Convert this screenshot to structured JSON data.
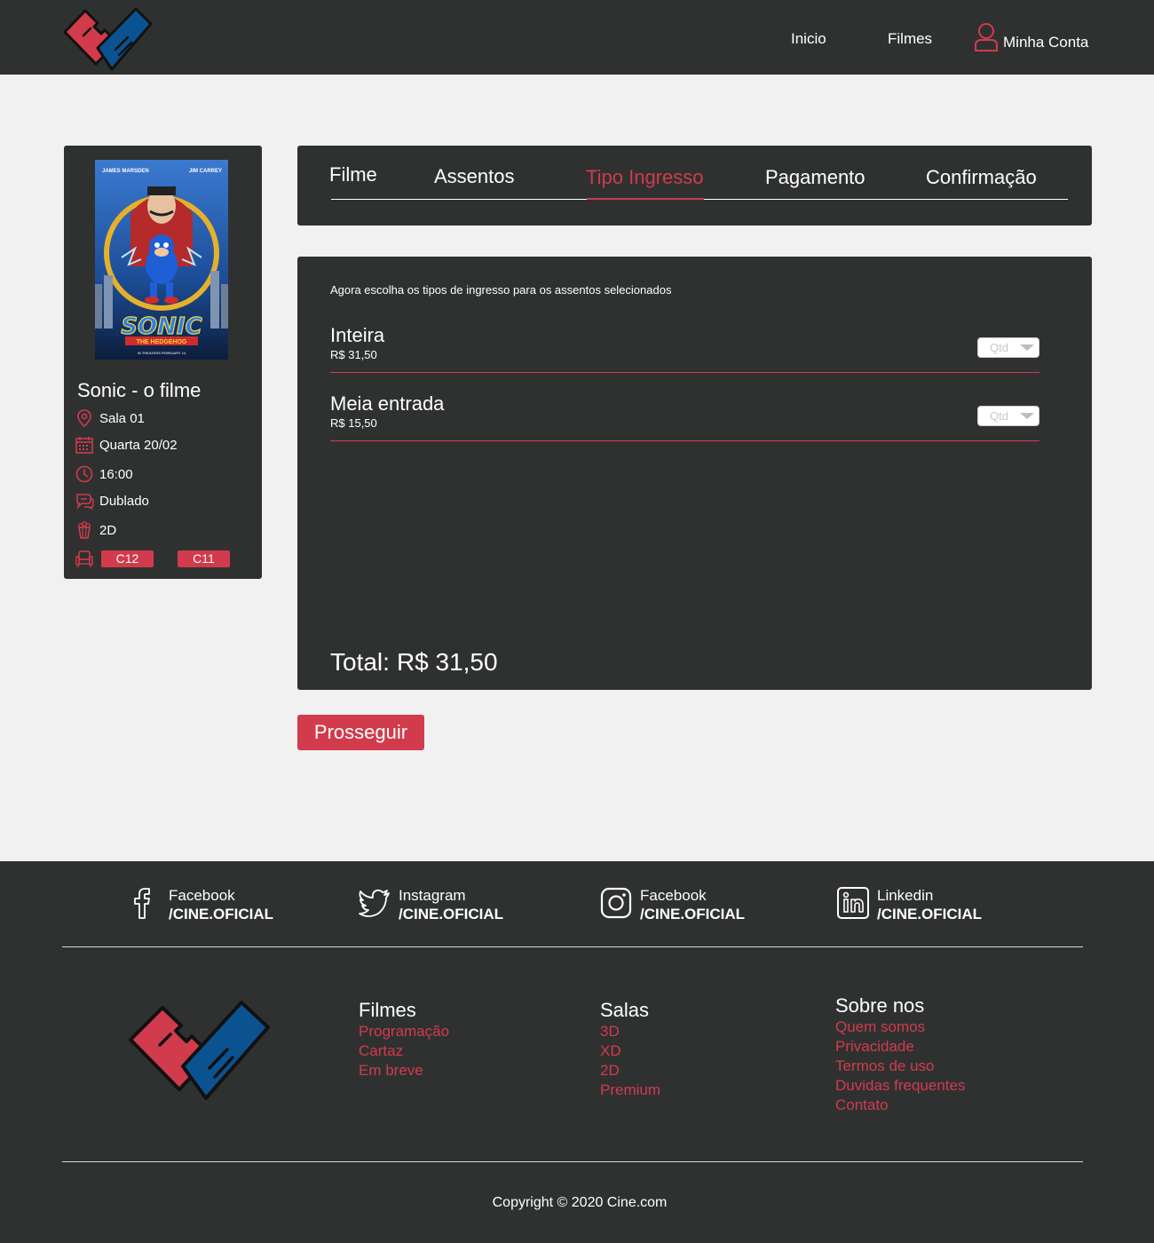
{
  "header": {
    "nav": {
      "inicio": "Inicio",
      "filmes": "Filmes",
      "account": "Minha Conta"
    }
  },
  "colors": {
    "accent": "#d13b4b",
    "panel": "#2f3131",
    "page_bg": "#f1f1f1",
    "logo_blue": "#0b5390"
  },
  "movie": {
    "title": "Sonic - o filme",
    "poster": {
      "actor_left": "JAMES MARSDEN",
      "actor_right": "JIM CARREY",
      "title": "SONIC",
      "subtitle": "THE HEDGEHOG",
      "tagline": "IN THEATERS FEBRUARY 14"
    },
    "room": "Sala 01",
    "date": "Quarta 20/02",
    "time": "16:00",
    "audio": "Dublado",
    "format": "2D",
    "seats": [
      "C12",
      "C11"
    ]
  },
  "steps": {
    "filme": "Filme",
    "assentos": "Assentos",
    "tipo_ingresso": "Tipo Ingresso",
    "pagamento": "Pagamento",
    "confirmacao": "Confirmação",
    "active": "Tipo Ingresso"
  },
  "tickets": {
    "instruction": "Agora escolha os tipos de ingresso para os assentos selecionados",
    "items": [
      {
        "name": "Inteira",
        "price": "R$ 31,50",
        "qty_placeholder": "Qtd"
      },
      {
        "name": "Meia entrada",
        "price": "R$ 15,50",
        "qty_placeholder": "Qtd"
      }
    ],
    "total_label": "Total:",
    "total_value": "R$ 31,50"
  },
  "proceed_label": "Prosseguir",
  "footer": {
    "social": [
      {
        "icon": "facebook-icon",
        "network": "Facebook",
        "handle": "/CINE.OFICIAL"
      },
      {
        "icon": "twitter-icon",
        "network": "Instagram",
        "handle": "/CINE.OFICIAL"
      },
      {
        "icon": "instagram-icon",
        "network": "Facebook",
        "handle": "/CINE.OFICIAL"
      },
      {
        "icon": "linkedin-icon",
        "network": "Linkedin",
        "handle": "/CINE.OFICIAL"
      }
    ],
    "columns": [
      {
        "title": "Filmes",
        "links": [
          "Programação",
          "Cartaz",
          "Em breve"
        ]
      },
      {
        "title": "Salas",
        "links": [
          "3D",
          "XD",
          "2D",
          "Premium"
        ]
      },
      {
        "title": "Sobre nos",
        "links": [
          "Quem somos",
          "Privacidade",
          "Termos de uso",
          "Duvidas frequentes",
          "Contato"
        ]
      }
    ],
    "copyright": "Copyright © 2020 Cine.com"
  }
}
